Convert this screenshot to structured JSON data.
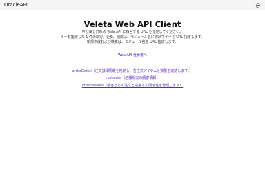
{
  "header": {
    "app_name": "OracleAPI",
    "settings_icon": "gear-icon"
  },
  "main": {
    "title": "Veleta Web API Client",
    "description_lines": [
      "呼び出し対象の Web API に相当する URL を指定してください。",
      "キーを指定した 1 件の取得、更新、削除は、モジュール名に続けてキーを URL 指定します。",
      "新規作成および検索は、モジュール名を URL 指定します。"
    ],
    "spec_link": "Web API 仕様書へ",
    "modules": [
      "orderDetail（注文詳細情報を格納し、各注文アイテムと数量を追跡します。）",
      "customer（店舗販売の顧客情報）",
      "orderHeader（顧客からの注文と店舗との関係性を管理します）"
    ]
  },
  "colors": {
    "link": "#2a2ad6",
    "visited_link": "#5b2db8",
    "topbar": "#f5f5f5"
  }
}
